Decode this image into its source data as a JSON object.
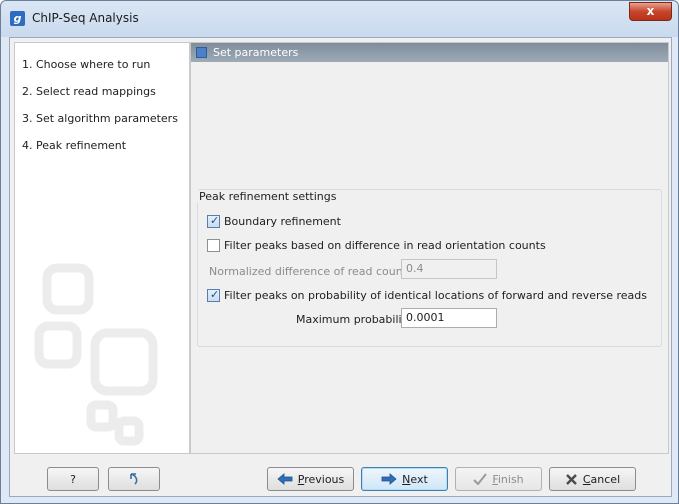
{
  "window": {
    "title": "ChIP-Seq Analysis",
    "app_icon_glyph": "g",
    "close_glyph": "x"
  },
  "steps": [
    "1.  Choose where to run",
    "2.  Select read mappings",
    "3.  Set algorithm parameters",
    "4.  Peak refinement"
  ],
  "section_header": "Set parameters",
  "group": {
    "title": "Peak refinement settings",
    "boundary_refinement": {
      "label": "Boundary refinement",
      "checked": true
    },
    "filter_orientation": {
      "label": "Filter peaks based on difference in read orientation counts",
      "checked": false
    },
    "normalized_difference": {
      "label": "Normalized difference of read counts",
      "value": "0.4"
    },
    "filter_probability": {
      "label": "Filter peaks on probability of identical locations of forward and reverse reads",
      "checked": true
    },
    "max_probability": {
      "label": "Maximum probability",
      "value": "0.0001"
    }
  },
  "buttons": {
    "help": "?",
    "reset_icon": "reset-icon",
    "previous_prefix": "",
    "previous_ul": "P",
    "previous_rest": "revious",
    "next_ul": "N",
    "next_rest": "ext",
    "finish_ul": "F",
    "finish_rest": "inish",
    "cancel_ul": "C",
    "cancel_rest": "ancel"
  },
  "colors": {
    "accent": "#2d6cc0",
    "header": "#8a97a5",
    "close": "#c7452b"
  }
}
